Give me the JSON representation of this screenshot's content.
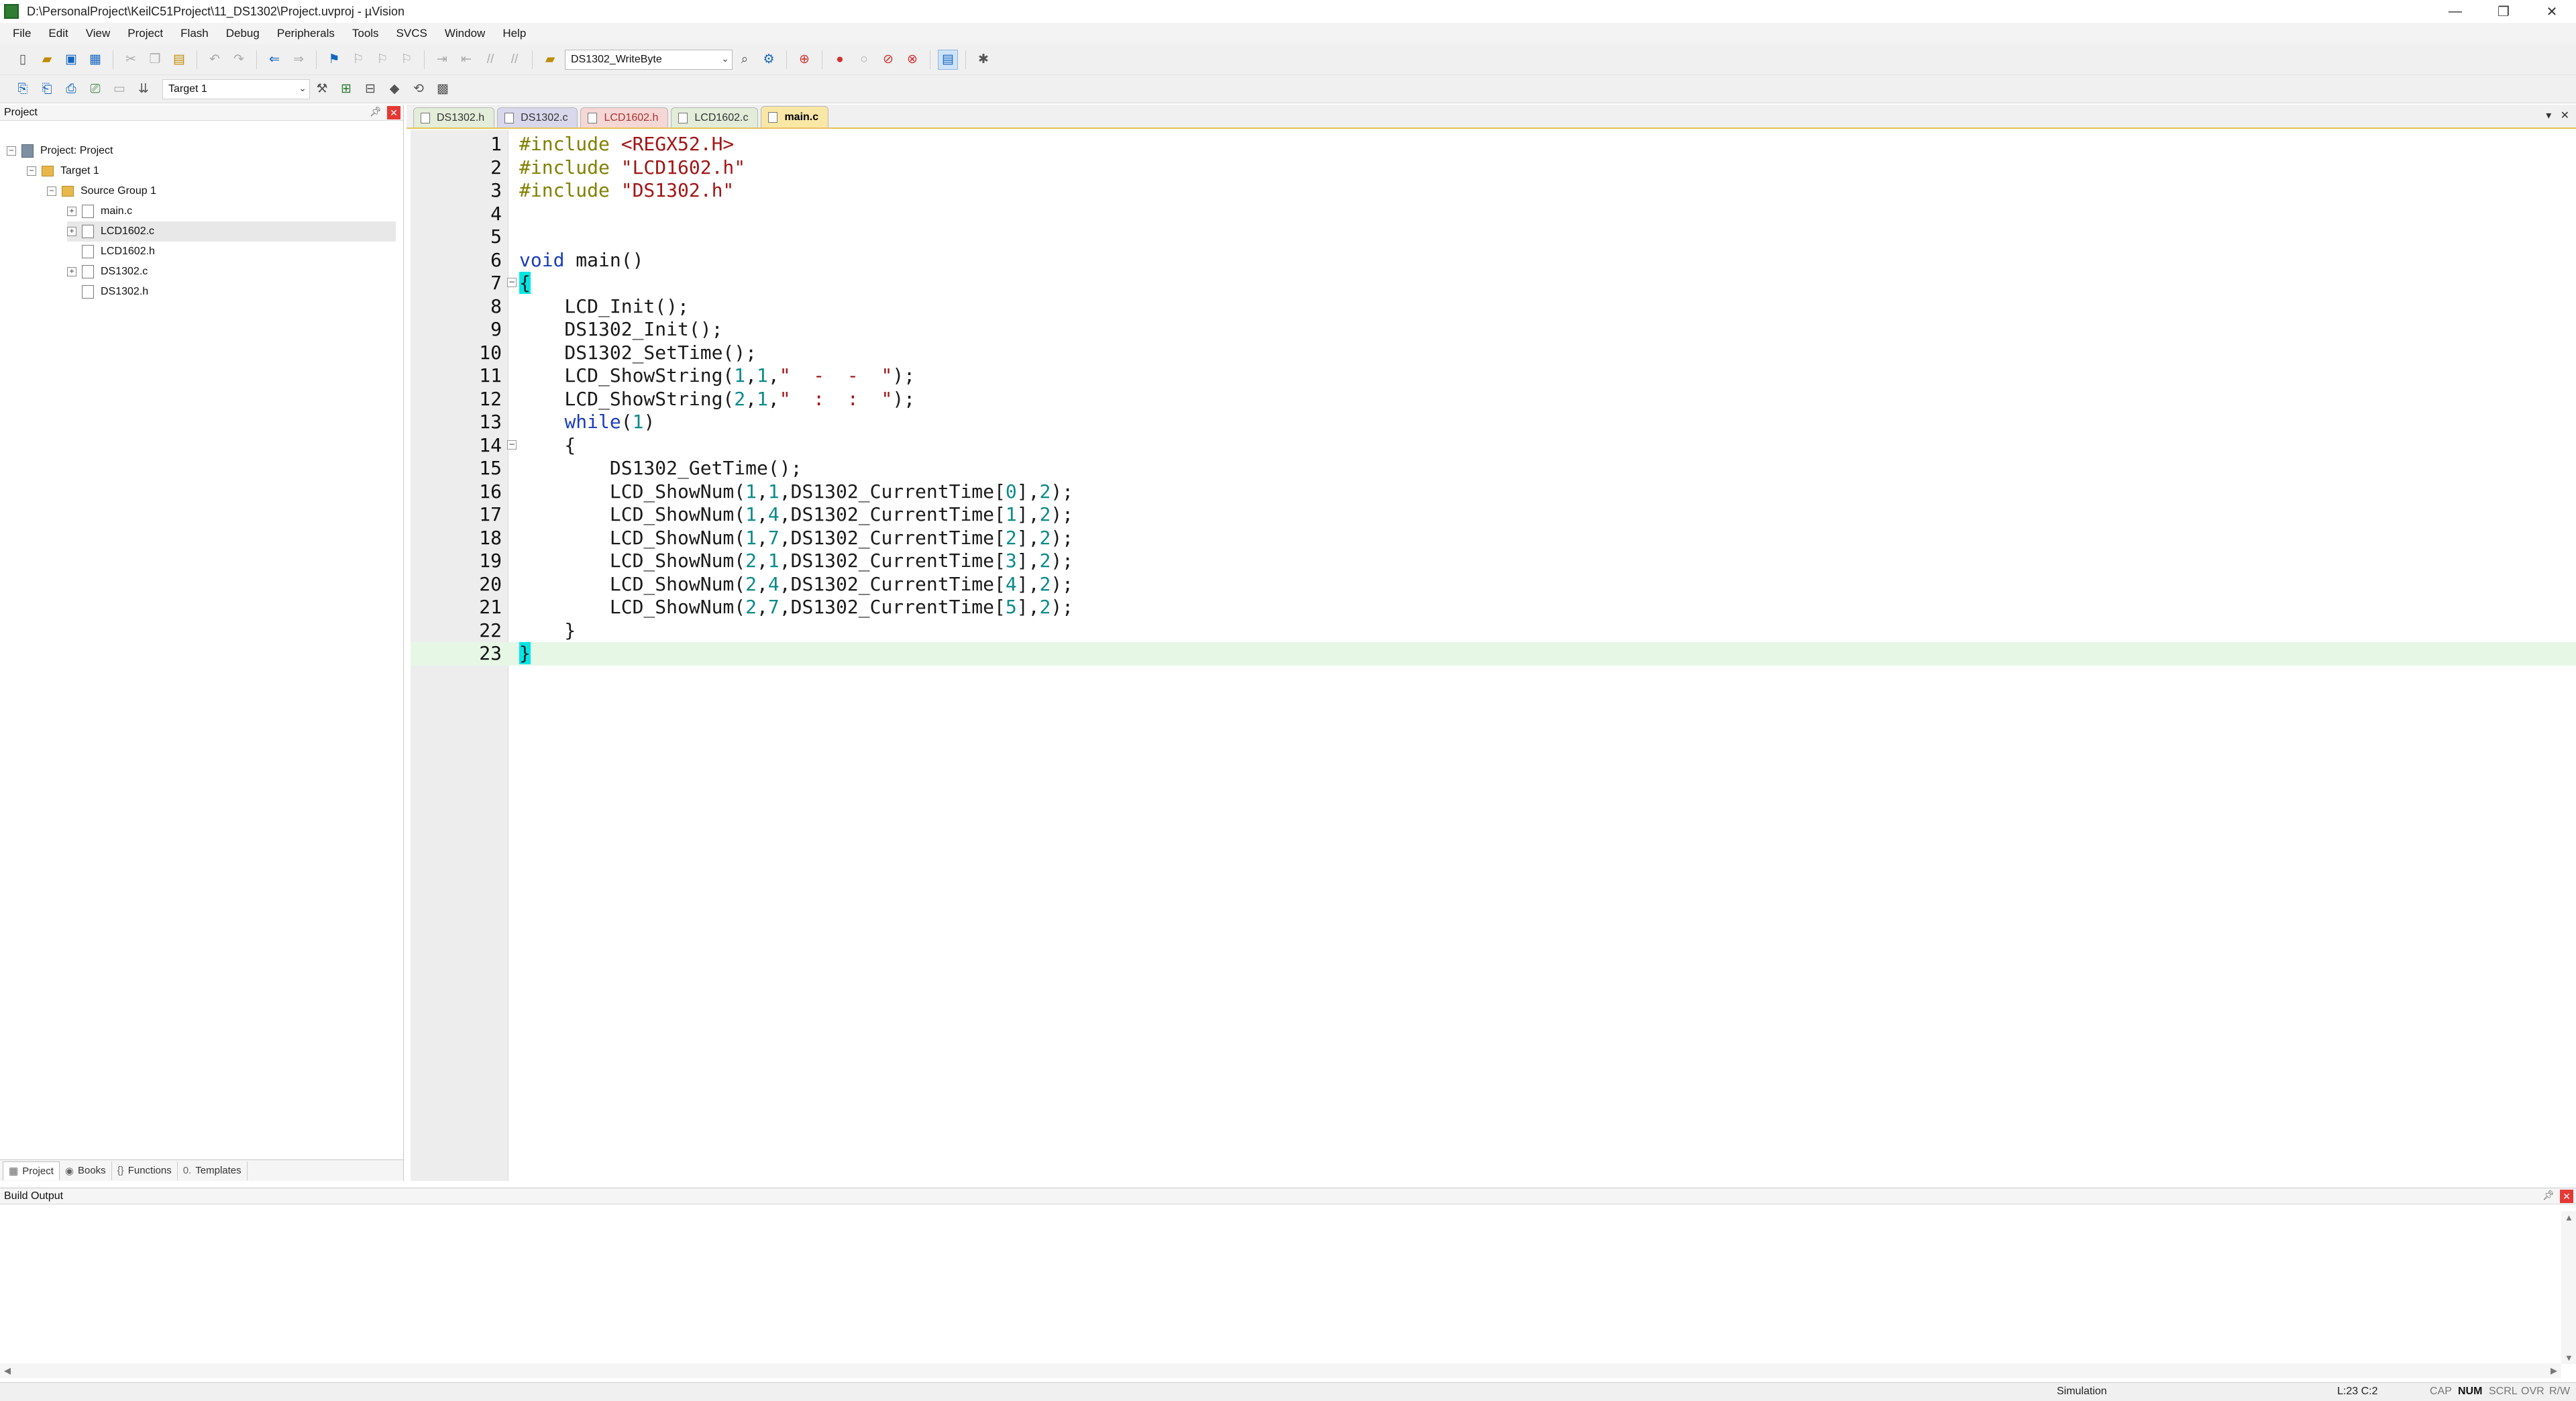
{
  "window": {
    "title": "D:\\PersonalProject\\KeilC51Project\\11_DS1302\\Project.uvproj - µVision",
    "controls": {
      "minimize": "—",
      "restore": "❐",
      "close": "✕"
    }
  },
  "menu": [
    "File",
    "Edit",
    "View",
    "Project",
    "Flash",
    "Debug",
    "Peripherals",
    "Tools",
    "SVCS",
    "Window",
    "Help"
  ],
  "toolbar": {
    "function_combo": "DS1302_WriteByte",
    "target_combo": "Target 1"
  },
  "project_pane": {
    "title": "Project",
    "tree": {
      "root": "Project: Project",
      "target": "Target 1",
      "group": "Source Group 1",
      "files": [
        "main.c",
        "LCD1602.c",
        "LCD1602.h",
        "DS1302.c",
        "DS1302.h"
      ]
    },
    "tabs": [
      "Project",
      "Books",
      "Functions",
      "Templates"
    ]
  },
  "editor": {
    "tabs": [
      "DS1302.h",
      "DS1302.c",
      "LCD1602.h",
      "LCD1602.c",
      "main.c"
    ],
    "active_tab": "main.c",
    "current_line": 23,
    "lines": [
      "#include <REGX52.H>",
      "#include \"LCD1602.h\"",
      "#include \"DS1302.h\"",
      "",
      "",
      "void main()",
      "{",
      "    LCD_Init();",
      "    DS1302_Init();",
      "    DS1302_SetTime();",
      "    LCD_ShowString(1,1,\"  -  -  \");",
      "    LCD_ShowString(2,1,\"  :  :  \");",
      "    while(1)",
      "    {",
      "        DS1302_GetTime();",
      "        LCD_ShowNum(1,1,DS1302_CurrentTime[0],2);",
      "        LCD_ShowNum(1,4,DS1302_CurrentTime[1],2);",
      "        LCD_ShowNum(1,7,DS1302_CurrentTime[2],2);",
      "        LCD_ShowNum(2,1,DS1302_CurrentTime[3],2);",
      "        LCD_ShowNum(2,4,DS1302_CurrentTime[4],2);",
      "        LCD_ShowNum(2,7,DS1302_CurrentTime[5],2);",
      "    }",
      "}"
    ]
  },
  "build_output": {
    "title": "Build Output"
  },
  "statusbar": {
    "mode": "Simulation",
    "position": "L:23 C:2",
    "indicators": [
      "CAP",
      "NUM",
      "SCRL",
      "OVR",
      "R/W"
    ],
    "active_indicator": "NUM"
  },
  "colors": {
    "keyword": "#1a3cbe",
    "preprocessor": "#808000",
    "string": "#a31515",
    "number": "#0a8a8a",
    "current_line_bg": "#e6f7e6",
    "brace_highlight": "#00e5e5",
    "active_tab_bg": "#f9e7a6"
  }
}
